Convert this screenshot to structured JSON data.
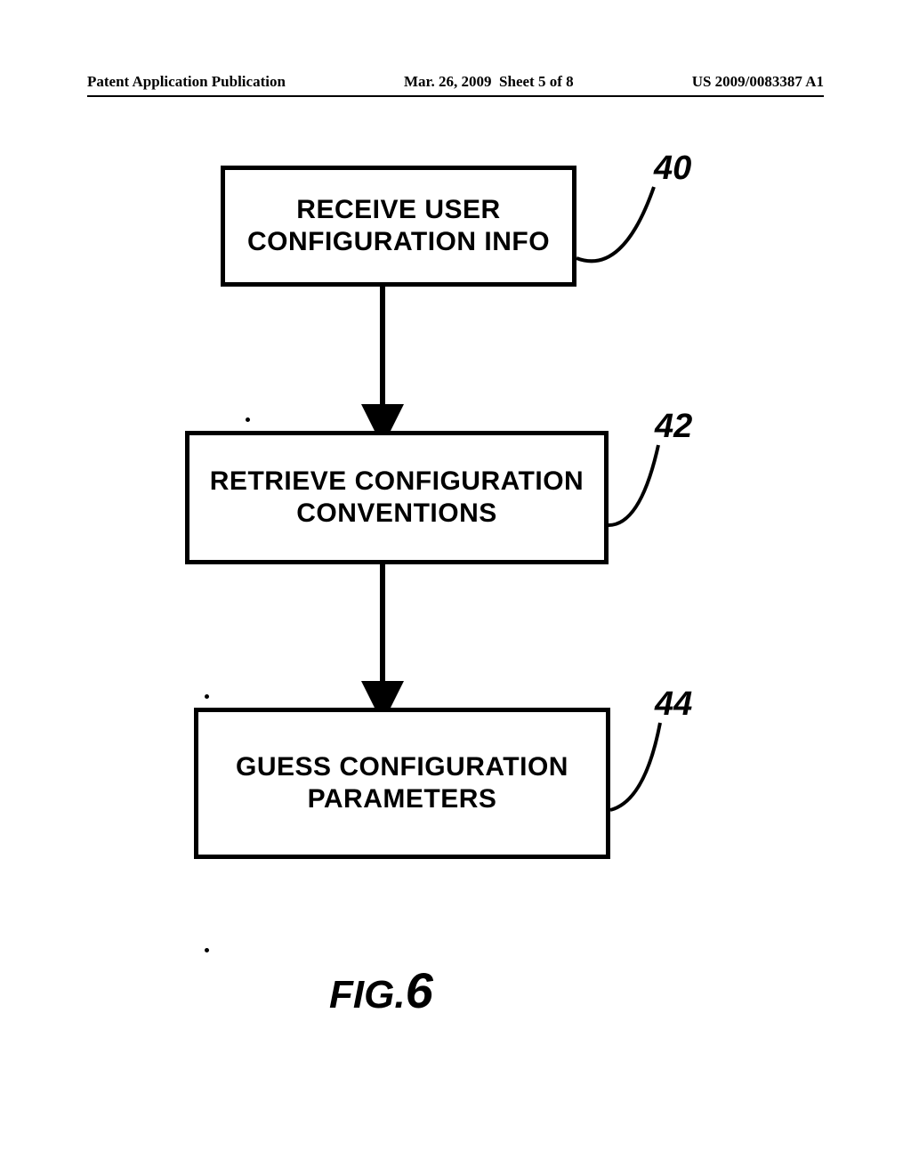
{
  "header": {
    "left": "Patent Application Publication",
    "mid_date": "Mar. 26, 2009",
    "mid_sheet": "Sheet 5 of 8",
    "right": "US 2009/0083387 A1"
  },
  "flowchart": {
    "steps": [
      {
        "label": "RECEIVE USER\nCONFIGURATION INFO",
        "ref": "40"
      },
      {
        "label": "RETRIEVE CONFIGURATION\nCONVENTIONS",
        "ref": "42"
      },
      {
        "label": "GUESS CONFIGURATION\nPARAMETERS",
        "ref": "44"
      }
    ]
  },
  "figure": {
    "prefix": "FIG.",
    "number": "6"
  }
}
